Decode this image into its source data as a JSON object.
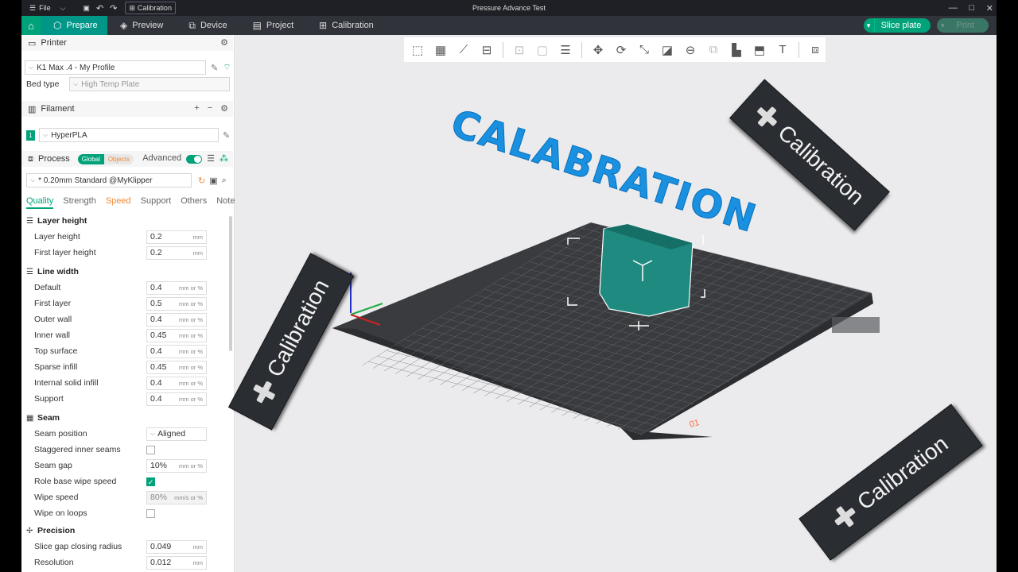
{
  "titlebar": {
    "file_label": "File",
    "calibration_tab": "Calibration",
    "title": "Pressure Advance Test",
    "min": "—",
    "max": "☐",
    "close": "✕"
  },
  "nav": {
    "tabs": [
      {
        "label": "Prepare"
      },
      {
        "label": "Preview"
      },
      {
        "label": "Device"
      },
      {
        "label": "Project"
      },
      {
        "label": "Calibration"
      }
    ],
    "slice_label": "Slice plate",
    "print_label": "Print"
  },
  "printer": {
    "header": "Printer",
    "profile": "K1 Max .4 - My Profile",
    "bed_type_label": "Bed type",
    "bed_type_value": "High Temp Plate"
  },
  "filament": {
    "header": "Filament",
    "slot": "1",
    "value": "HyperPLA"
  },
  "process": {
    "header": "Process",
    "global_label": "Global",
    "objects_label": "Objects",
    "advanced_label": "Advanced",
    "profile": "* 0.20mm Standard @MyKlipper",
    "tabs": [
      "Quality",
      "Strength",
      "Speed",
      "Support",
      "Others",
      "Notes"
    ]
  },
  "groups": {
    "layer_height": "Layer height",
    "line_width": "Line width",
    "seam": "Seam",
    "precision": "Precision"
  },
  "params": {
    "layer_height": {
      "label": "Layer height",
      "value": "0.2",
      "unit": "mm"
    },
    "first_layer_height": {
      "label": "First layer height",
      "value": "0.2",
      "unit": "mm"
    },
    "lw_default": {
      "label": "Default",
      "value": "0.4",
      "unit": "mm or %"
    },
    "lw_first_layer": {
      "label": "First layer",
      "value": "0.5",
      "unit": "mm or %"
    },
    "lw_outer_wall": {
      "label": "Outer wall",
      "value": "0.4",
      "unit": "mm or %"
    },
    "lw_inner_wall": {
      "label": "Inner wall",
      "value": "0.45",
      "unit": "mm or %"
    },
    "lw_top_surface": {
      "label": "Top surface",
      "value": "0.4",
      "unit": "mm or %"
    },
    "lw_sparse_infill": {
      "label": "Sparse infill",
      "value": "0.45",
      "unit": "mm or %"
    },
    "lw_internal_solid": {
      "label": "Internal solid infill",
      "value": "0.4",
      "unit": "mm or %"
    },
    "lw_support": {
      "label": "Support",
      "value": "0.4",
      "unit": "mm or %"
    },
    "seam_position": {
      "label": "Seam position",
      "value": "Aligned"
    },
    "staggered": {
      "label": "Staggered inner seams"
    },
    "seam_gap": {
      "label": "Seam gap",
      "value": "10%",
      "unit": "mm or %"
    },
    "role_wipe": {
      "label": "Role base wipe speed"
    },
    "wipe_speed": {
      "label": "Wipe speed",
      "value": "80%",
      "unit": "mm/s or %"
    },
    "wipe_loops": {
      "label": "Wipe on loops"
    },
    "slice_gap": {
      "label": "Slice gap closing radius",
      "value": "0.049",
      "unit": "mm"
    },
    "resolution": {
      "label": "Resolution",
      "value": "0.012",
      "unit": "mm"
    }
  },
  "overlay": {
    "big_text": "CALABRATION",
    "banner_text": "Calibration"
  },
  "plate": {
    "plate_number": "01"
  }
}
